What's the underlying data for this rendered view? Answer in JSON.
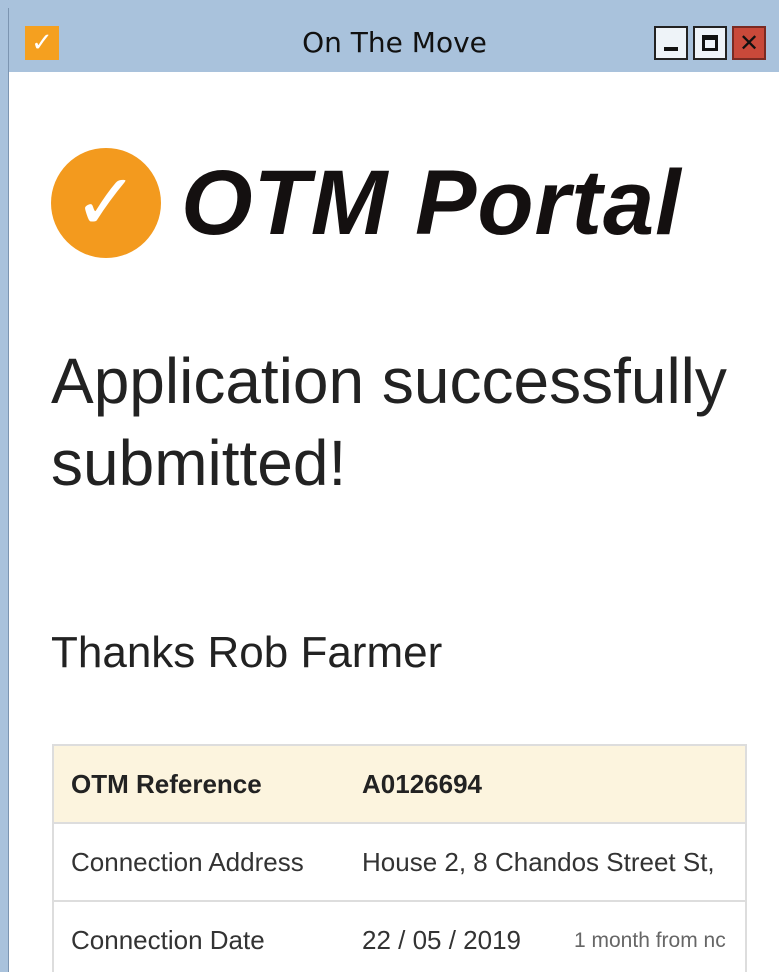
{
  "window": {
    "title": "On The Move",
    "icon": "orange-check-icon",
    "controls": {
      "minimize": "minimize-icon",
      "maximize": "maximize-icon",
      "close_glyph": "✕"
    }
  },
  "logo": {
    "check_glyph": "✓",
    "text": "OTM Portal",
    "colors": {
      "circle": "#f39a1e",
      "text": "#141010"
    }
  },
  "main": {
    "headline": "Application successfully submitted!",
    "thanks": "Thanks Rob Farmer"
  },
  "details": {
    "rows": [
      {
        "label": "OTM Reference",
        "value": "A0126694"
      },
      {
        "label": "Connection Address",
        "value": "House 2, 8 Chandos Street St,"
      },
      {
        "label": "Connection Date",
        "value": "22 / 05 / 2019",
        "hint": "1 month from nc"
      }
    ]
  },
  "colors": {
    "titlebar": "#a9c2dc",
    "header_row": "#fcf4de",
    "close_button": "#c9493a"
  }
}
